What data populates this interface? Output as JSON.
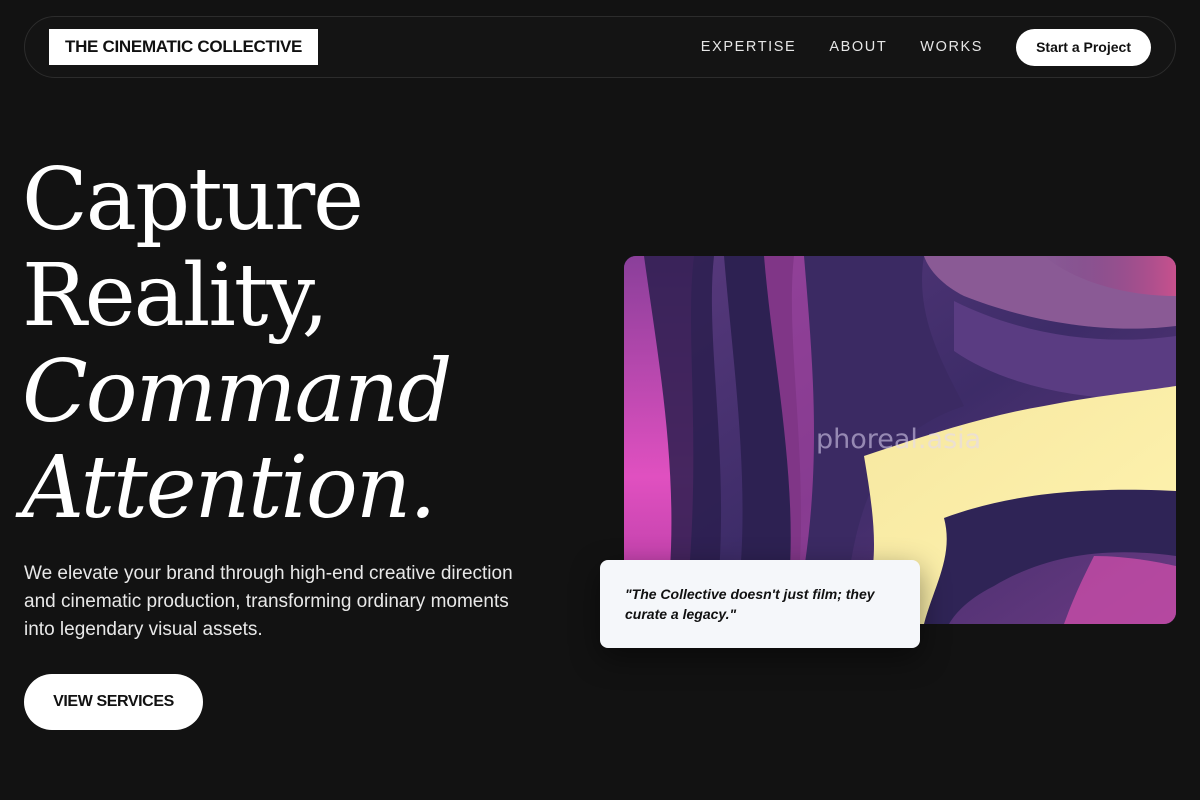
{
  "header": {
    "logo": "THE CINEMATIC COLLECTIVE",
    "nav": [
      "EXPERTISE",
      "ABOUT",
      "WORKS"
    ],
    "cta": "Start a Project"
  },
  "hero": {
    "title_lines": [
      "Capture",
      "Reality,",
      "Command",
      "Attention."
    ],
    "description": "We elevate your brand through high-end creative direction and cinematic production, transforming ordinary moments into legendary visual assets.",
    "button": "VIEW SERVICES"
  },
  "media": {
    "watermark": "phoreal.asia",
    "quote": "\"The Collective doesn't just film; they curate a legacy.\""
  },
  "colors": {
    "background": "#121212",
    "accent_purple": "#3f2d6e",
    "accent_magenta": "#d14bb8",
    "accent_yellow": "#fdf0a0"
  }
}
